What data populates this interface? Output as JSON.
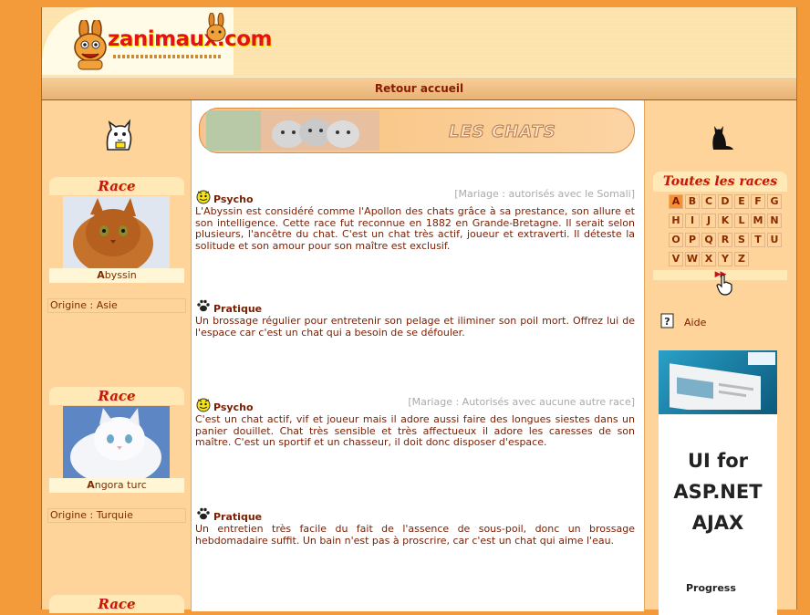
{
  "site": {
    "logo_text": "zanimaux.com"
  },
  "nav": {
    "home_link": "Retour accueil"
  },
  "banner": {
    "title": "LES CHATS"
  },
  "left": {
    "races": [
      {
        "title": "Race",
        "name_initial": "A",
        "name_rest": "byssin",
        "origin": "Origine : Asie"
      },
      {
        "title": "Race",
        "name_initial": "A",
        "name_rest": "ngora turc",
        "origin": "Origine : Turquie"
      },
      {
        "title": "Race"
      }
    ]
  },
  "entries": [
    {
      "icon": "psycho-icon",
      "title": "Psycho",
      "note": "[Mariage : autorisés avec le Somali]",
      "text": "L'Abyssin est considéré comme l'Apollon des chats grâce à sa prestance, son allure et son intelligence. Cette race fut reconnue en 1882 en Grande-Bretagne. Il serait selon plusieurs, l'ancêtre du chat. C'est un chat très actif, joueur et extraverti. Il déteste la solitude et son amour pour son maître est exclusif."
    },
    {
      "icon": "paw-icon",
      "title": "Pratique",
      "note": "",
      "text": "Un brossage régulier pour entretenir son pelage et iliminer son poil mort. Offrez lui de l'espace car c'est un chat qui a besoin de se défouler."
    },
    {
      "icon": "psycho-icon",
      "title": "Psycho",
      "note": "[Mariage : Autorisés avec aucune autre race]",
      "text": "C'est un chat actif, vif et joueur mais il adore aussi faire des longues siestes dans un panier douillet. Chat très sensible et très affectueux il adore les caresses de son maître. C'est un sportif et un chasseur, il doit donc disposer d'espace."
    },
    {
      "icon": "paw-icon",
      "title": "Pratique",
      "note": "",
      "text": "Un entretien très facile du fait de l'assence de sous-poil, donc un brossage hebdomadaire suffit. Un bain n'est pas à proscrire, car c'est un chat qui aime l'eau."
    }
  ],
  "right": {
    "alpha_title": "Toutes les races",
    "letters": [
      "A",
      "B",
      "C",
      "D",
      "E",
      "F",
      "G",
      "H",
      "I",
      "J",
      "K",
      "L",
      "M",
      "N",
      "O",
      "P",
      "Q",
      "R",
      "S",
      "T",
      "U",
      "V",
      "W",
      "X",
      "Y",
      "Z"
    ],
    "active_letter": "A",
    "more": "▶▶",
    "help": "Aide",
    "ad": {
      "headline": "UI for ASP.NET AJAX",
      "brand": "Progress"
    }
  }
}
